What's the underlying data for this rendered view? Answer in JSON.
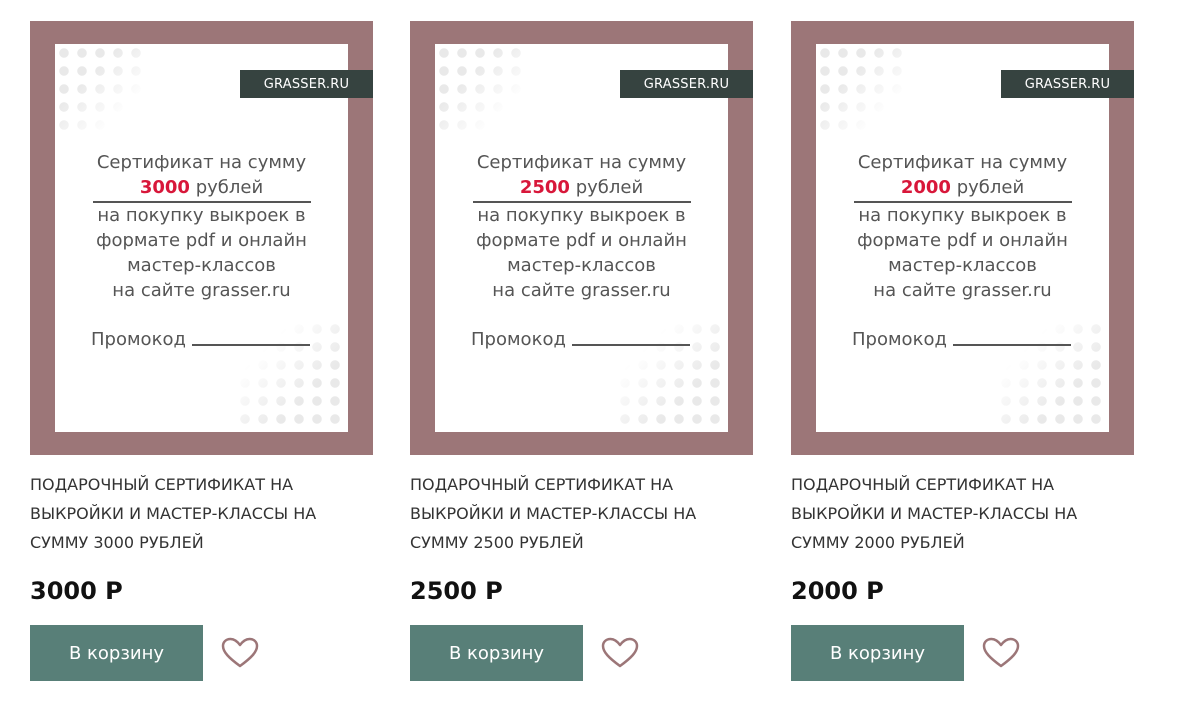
{
  "colors": {
    "frame": "#9c7678",
    "brand_bg": "#364340",
    "amount": "#d8173a",
    "button": "#587f78"
  },
  "products": [
    {
      "brand": "GRASSER.RU",
      "cert_line1": "Сертификат на сумму",
      "cert_amount": "3000",
      "cert_currency": "рублей",
      "cert_line3": "на покупку выкроек  в",
      "cert_line4": "формате pdf и онлайн",
      "cert_line5": "мастер-классов",
      "cert_line6": "на сайте grasser.ru",
      "promo_label": "Промокод",
      "title_line1": "ПОДАРОЧНЫЙ СЕРТИФИКАТ НА",
      "title_line2": "ВЫКРОЙКИ И МАСТЕР-КЛАССЫ НА",
      "title_line3": "СУММУ 3000 РУБЛЕЙ",
      "price": "3000 Р",
      "cart_label": "В корзину",
      "favorite_icon": "heart-icon"
    },
    {
      "brand": "GRASSER.RU",
      "cert_line1": "Сертификат на сумму",
      "cert_amount": "2500",
      "cert_currency": "рублей",
      "cert_line3": "на покупку выкроек  в",
      "cert_line4": "формате pdf и онлайн",
      "cert_line5": "мастер-классов",
      "cert_line6": "на сайте grasser.ru",
      "promo_label": "Промокод",
      "title_line1": "ПОДАРОЧНЫЙ СЕРТИФИКАТ НА",
      "title_line2": "ВЫКРОЙКИ И МАСТЕР-КЛАССЫ НА",
      "title_line3": "СУММУ 2500 РУБЛЕЙ",
      "price": "2500 Р",
      "cart_label": "В корзину",
      "favorite_icon": "heart-icon"
    },
    {
      "brand": "GRASSER.RU",
      "cert_line1": "Сертификат на сумму",
      "cert_amount": "2000",
      "cert_currency": "рублей",
      "cert_line3": "на покупку выкроек  в",
      "cert_line4": "формате pdf и онлайн",
      "cert_line5": "мастер-классов",
      "cert_line6": "на сайте grasser.ru",
      "promo_label": "Промокод",
      "title_line1": "ПОДАРОЧНЫЙ СЕРТИФИКАТ НА",
      "title_line2": "ВЫКРОЙКИ И МАСТЕР-КЛАССЫ НА",
      "title_line3": "СУММУ 2000 РУБЛЕЙ",
      "price": "2000 Р",
      "cart_label": "В корзину",
      "favorite_icon": "heart-icon"
    }
  ]
}
